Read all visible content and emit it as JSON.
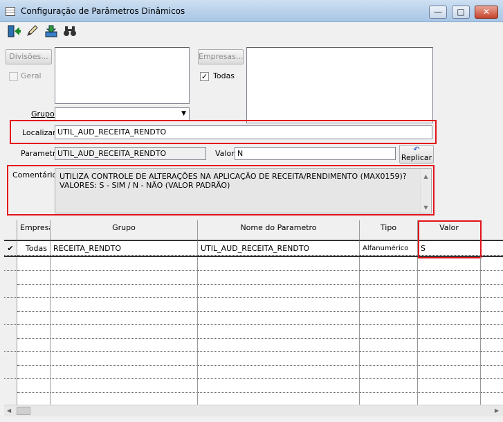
{
  "window": {
    "title": "Configuração de Parâmetros Dinâmicos"
  },
  "toolbar": {
    "icons": [
      "exit-icon",
      "pencil-icon",
      "save-icon",
      "binoculars-icon"
    ]
  },
  "filters": {
    "divisoes_button": "Divisões...",
    "geral_label": "Geral",
    "geral_checked": false,
    "empresas_button": "Empresas...",
    "todas_label": "Todas",
    "todas_checked": true,
    "grupo_label": "Grupo",
    "grupo_value": ""
  },
  "localizar": {
    "label": "Localizar",
    "value": "UTIL_AUD_RECEITA_RENDTO"
  },
  "parametro": {
    "label": "Parametro",
    "value": "UTIL_AUD_RECEITA_RENDTO"
  },
  "valor": {
    "label": "Valor",
    "value": "N"
  },
  "replicar_button": "Replicar",
  "comentarios": {
    "label": "Comentários",
    "line1": "UTILIZA CONTROLE DE ALTERAÇÕES NA APLICAÇÃO DE RECEITA/RENDIMENTO (MAX0159)?",
    "line2": "VALORES: S - SIM / N - NÃO (VALOR PADRÃO)"
  },
  "grid": {
    "columns": [
      "Empresa",
      "Grupo",
      "Nome do Parametro",
      "Tipo",
      "Valor"
    ],
    "rows": [
      {
        "empresa": "Todas",
        "grupo": "RECEITA_RENDTO",
        "nome": "UTIL_AUD_RECEITA_RENDTO",
        "tipo": "Alfanumérico",
        "valor": "S"
      }
    ]
  }
}
